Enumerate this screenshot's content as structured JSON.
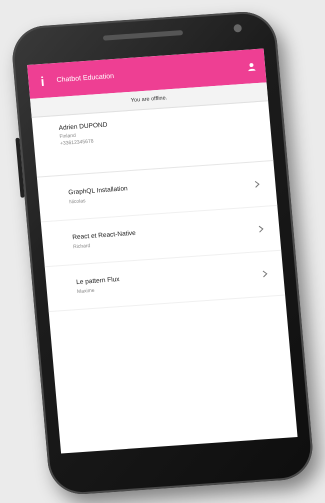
{
  "app": {
    "title": "Chatbot Education",
    "logo_letter": "i",
    "accent_color": "#ee3f93"
  },
  "status": {
    "offline_text": "You are offline."
  },
  "user": {
    "name": "Adrien DUPOND",
    "org": "Finland",
    "phone": "+33612345678"
  },
  "items": [
    {
      "title": "GraphQL Installation",
      "subtitle": "Nicolas"
    },
    {
      "title": "React et React-Native",
      "subtitle": "Richard"
    },
    {
      "title": "Le pattern Flux",
      "subtitle": "Maxime"
    }
  ],
  "icons": {
    "logo": "app-logo-icon",
    "profile": "person-icon",
    "chevron": "chevron-right-icon"
  }
}
